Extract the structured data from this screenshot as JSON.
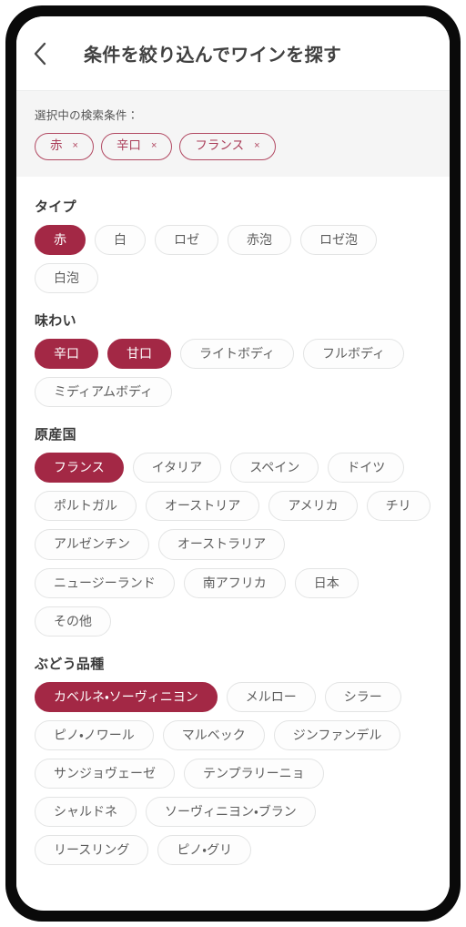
{
  "header": {
    "back_icon": "chevron-left-icon",
    "title": "条件を絞り込んでワインを探す"
  },
  "selected_conditions": {
    "label": "選択中の検索条件：",
    "remove_glyph": "×",
    "chips": [
      {
        "label": "赤"
      },
      {
        "label": "辛口"
      },
      {
        "label": "フランス"
      }
    ]
  },
  "colors": {
    "accent": "#a32845",
    "chip_outline": "#b24a63",
    "chip_border": "#e3e4e4",
    "band_bg": "#f5f5f5",
    "text": "#5d5d5d",
    "heading": "#3a3a3a"
  },
  "sections": [
    {
      "title": "タイプ",
      "options": [
        {
          "label": "赤",
          "selected": true
        },
        {
          "label": "白",
          "selected": false
        },
        {
          "label": "ロゼ",
          "selected": false
        },
        {
          "label": "赤泡",
          "selected": false
        },
        {
          "label": "ロゼ泡",
          "selected": false
        },
        {
          "label": "白泡",
          "selected": false
        }
      ]
    },
    {
      "title": "味わい",
      "options": [
        {
          "label": "辛口",
          "selected": true
        },
        {
          "label": "甘口",
          "selected": true
        },
        {
          "label": "ライトボディ",
          "selected": false
        },
        {
          "label": "フルボディ",
          "selected": false
        },
        {
          "label": "ミディアムボディ",
          "selected": false
        }
      ]
    },
    {
      "title": "原産国",
      "options": [
        {
          "label": "フランス",
          "selected": true
        },
        {
          "label": "イタリア",
          "selected": false
        },
        {
          "label": "スペイン",
          "selected": false
        },
        {
          "label": "ドイツ",
          "selected": false
        },
        {
          "label": "ポルトガル",
          "selected": false
        },
        {
          "label": "オーストリア",
          "selected": false
        },
        {
          "label": "アメリカ",
          "selected": false
        },
        {
          "label": "チリ",
          "selected": false
        },
        {
          "label": "アルゼンチン",
          "selected": false
        },
        {
          "label": "オーストラリア",
          "selected": false
        },
        {
          "label": "ニュージーランド",
          "selected": false
        },
        {
          "label": "南アフリカ",
          "selected": false
        },
        {
          "label": "日本",
          "selected": false
        },
        {
          "label": "その他",
          "selected": false
        }
      ]
    },
    {
      "title": "ぶどう品種",
      "options": [
        {
          "label": "カベルネ・ソーヴィニヨン",
          "selected": true
        },
        {
          "label": "メルロー",
          "selected": false
        },
        {
          "label": "シラー",
          "selected": false
        },
        {
          "label": "ピノ・ノワール",
          "selected": false
        },
        {
          "label": "マルベック",
          "selected": false
        },
        {
          "label": "ジンファンデル",
          "selected": false
        },
        {
          "label": "サンジョヴェーゼ",
          "selected": false
        },
        {
          "label": "テンプラリーニョ",
          "selected": false
        },
        {
          "label": "シャルドネ",
          "selected": false
        },
        {
          "label": "ソーヴィニヨン・ブラン",
          "selected": false
        },
        {
          "label": "リースリング",
          "selected": false
        },
        {
          "label": "ピノ・グリ",
          "selected": false
        }
      ]
    }
  ]
}
